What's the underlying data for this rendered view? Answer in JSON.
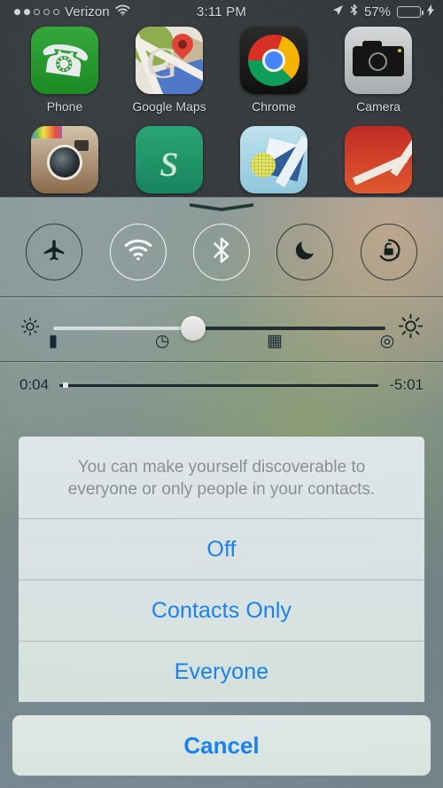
{
  "status_bar": {
    "signal_dots_filled": 2,
    "signal_dots_total": 5,
    "carrier": "Verizon",
    "wifi_icon": "wifi-icon",
    "time": "3:11 PM",
    "location_icon": "location-arrow-icon",
    "bluetooth_icon": "bluetooth-icon",
    "battery_percent": "57%",
    "battery_level": 57,
    "battery_color": "#4cd554",
    "charging_icon": "lightning-bolt-icon"
  },
  "home_screen": {
    "row1": [
      {
        "label": "Phone",
        "icon": "phone-icon"
      },
      {
        "label": "Google Maps",
        "icon": "google-maps-icon"
      },
      {
        "label": "Chrome",
        "icon": "chrome-icon"
      },
      {
        "label": "Camera",
        "icon": "camera-icon"
      }
    ],
    "row2": [
      {
        "label": "",
        "icon": "instagram-icon"
      },
      {
        "label": "",
        "icon": "green-app-icon"
      },
      {
        "label": "",
        "icon": "teal-app-icon"
      },
      {
        "label": "",
        "icon": "red-app-icon"
      }
    ]
  },
  "control_center": {
    "grabber": "grabber-handle",
    "toggles": [
      {
        "name": "airplane-mode",
        "icon": "airplane-icon",
        "state": "off"
      },
      {
        "name": "wifi",
        "icon": "wifi-icon",
        "state": "on"
      },
      {
        "name": "bluetooth",
        "icon": "bluetooth-icon",
        "state": "on"
      },
      {
        "name": "do-not-disturb",
        "icon": "moon-icon",
        "state": "off"
      },
      {
        "name": "rotation-lock",
        "icon": "rotation-lock-icon",
        "state": "off"
      }
    ],
    "brightness": {
      "low_icon": "brightness-low-icon",
      "high_icon": "brightness-high-icon",
      "value_percent": 42
    },
    "media": {
      "elapsed": "0:04",
      "remaining": "-5:01",
      "progress_percent": 1
    },
    "shortcuts": [
      {
        "name": "flashlight",
        "icon": "flashlight-icon",
        "glyph": "▮"
      },
      {
        "name": "timer",
        "icon": "timer-icon",
        "glyph": "◷"
      },
      {
        "name": "calculator",
        "icon": "calculator-icon",
        "glyph": "▦"
      },
      {
        "name": "camera",
        "icon": "camera-icon",
        "glyph": "◎"
      }
    ]
  },
  "action_sheet": {
    "message": "You can make yourself discoverable to everyone or only people in your contacts.",
    "options": [
      {
        "label": "Off"
      },
      {
        "label": "Contacts Only"
      },
      {
        "label": "Everyone"
      }
    ],
    "cancel_label": "Cancel",
    "accent_color": "#1a82f0"
  }
}
